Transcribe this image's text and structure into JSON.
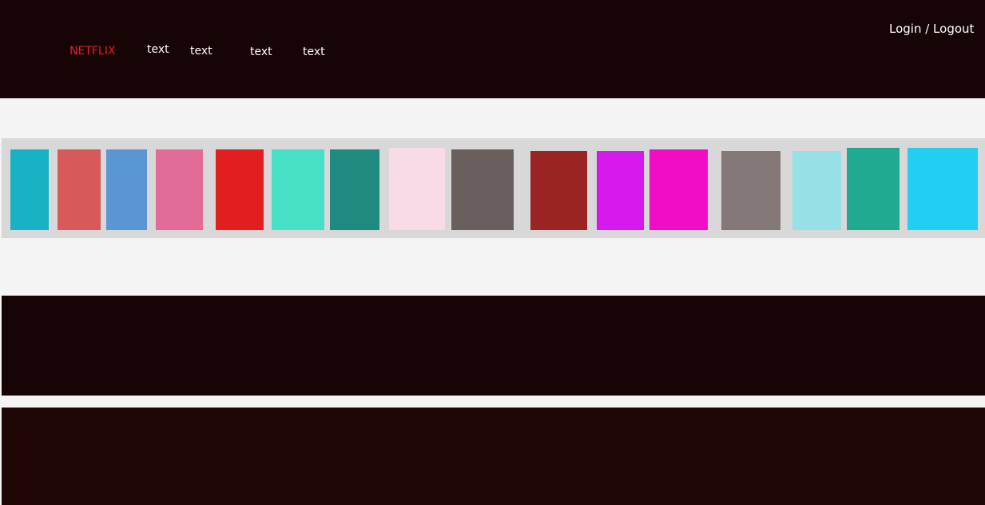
{
  "header": {
    "brand": "NETFLIX",
    "links": [
      "text",
      "text",
      "text",
      "text"
    ],
    "auth_label": "Login / Logout"
  },
  "colors": {
    "header_bg": "#170404",
    "brand": "#e32020",
    "page_bg": "#f4f4f4",
    "strip_bg": "#d8d8d8"
  },
  "tile_colors": [
    "#17b2c3",
    "#d65a5a",
    "#5996d3",
    "#e26c98",
    "#e21e1e",
    "#47e0c7",
    "#1e8b7e",
    "#f8dbe6",
    "#695f5d",
    "#9a2424",
    "#d519ed",
    "#f10cc5",
    "#847977",
    "#96e0e6",
    "#20aa92",
    "#23cef3"
  ]
}
